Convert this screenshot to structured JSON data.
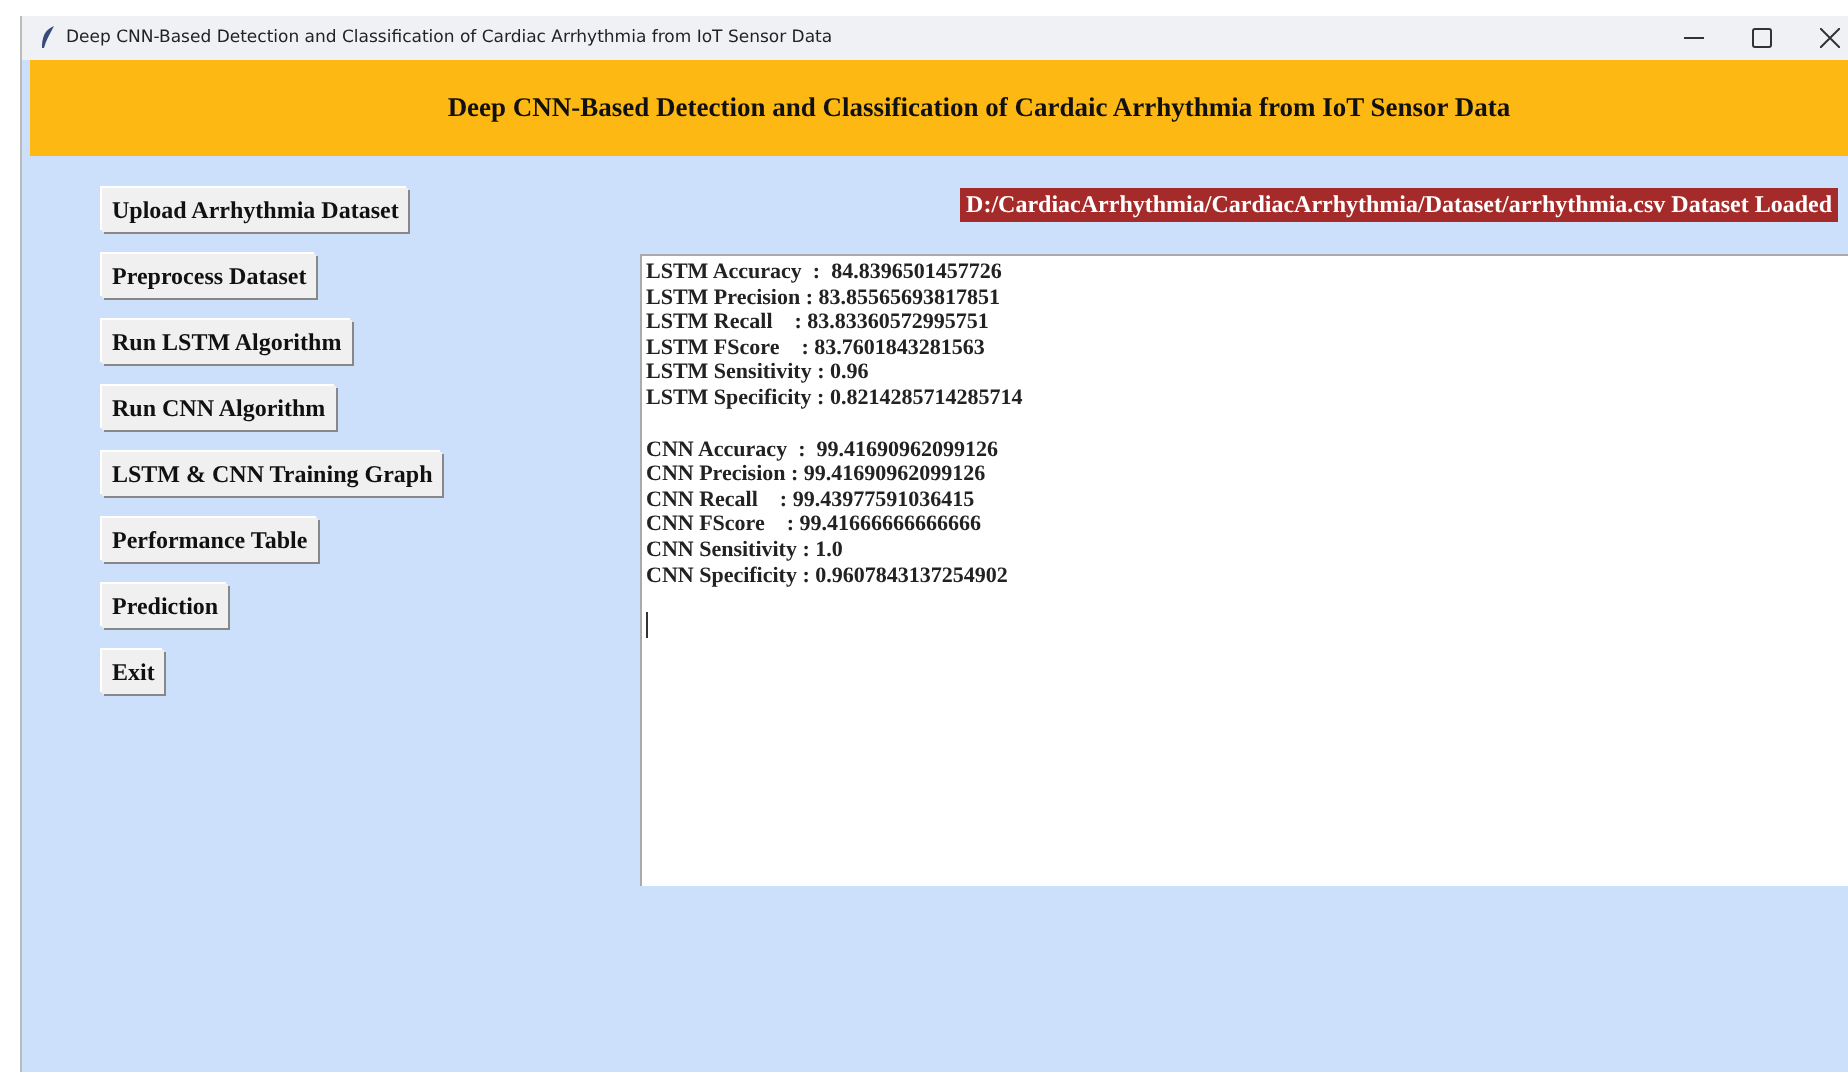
{
  "window": {
    "title": "Deep CNN-Based Detection and Classification of Cardiac Arrhythmia from IoT Sensor Data"
  },
  "header": {
    "title": "Deep CNN-Based Detection and Classification of Cardaic Arrhythmia from IoT Sensor Data"
  },
  "buttons": [
    {
      "label": "Upload Arrhythmia Dataset"
    },
    {
      "label": "Preprocess Dataset"
    },
    {
      "label": "Run LSTM Algorithm"
    },
    {
      "label": "Run CNN Algorithm"
    },
    {
      "label": "LSTM & CNN Training Graph"
    },
    {
      "label": "Performance Table"
    },
    {
      "label": "Prediction"
    },
    {
      "label": "Exit"
    }
  ],
  "status": "D:/CardiacArrhythmia/CardiacArrhythmia/Dataset/arrhythmia.csv Dataset Loaded",
  "output": {
    "blocks": [
      {
        "lines": [
          "LSTM Accuracy  :  84.8396501457726",
          "LSTM Precision : 83.85565693817851",
          "LSTM Recall    : 83.83360572995751",
          "LSTM FScore    : 83.7601843281563",
          "LSTM Sensitivity : 0.96",
          "LSTM Specificity : 0.8214285714285714"
        ]
      },
      {
        "lines": [
          "CNN Accuracy  :  99.41690962099126",
          "CNN Precision : 99.41690962099126",
          "CNN Recall    : 99.43977591036415",
          "CNN FScore    : 99.41666666666666",
          "CNN Sensitivity : 1.0",
          "CNN Specificity : 0.9607843137254902"
        ]
      }
    ],
    "cursor": true
  }
}
